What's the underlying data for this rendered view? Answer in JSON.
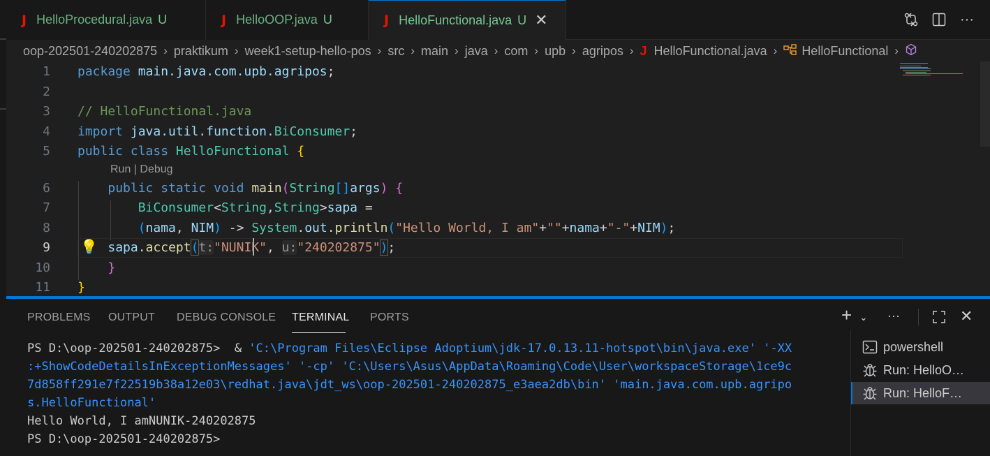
{
  "tabs": [
    {
      "icon": "J",
      "name": "HelloProcedural.java",
      "status": "U",
      "active": false
    },
    {
      "icon": "J",
      "name": "HelloOOP.java",
      "status": "U",
      "active": false
    },
    {
      "icon": "J",
      "name": "HelloFunctional.java",
      "status": "U",
      "active": true
    }
  ],
  "titlebar_actions": [
    "source-control-compare-icon",
    "split-editor-icon",
    "more-actions-icon"
  ],
  "breadcrumb": {
    "segments": [
      "oop-202501-240202875",
      "praktikum",
      "week1-setup-hello-pos",
      "src",
      "main",
      "java",
      "com",
      "upb",
      "agripos"
    ],
    "file": "HelloFunctional.java",
    "symbol": "HelloFunctional"
  },
  "editor": {
    "line_numbers": [
      "1",
      "2",
      "3",
      "4",
      "5",
      "6",
      "7",
      "8",
      "9",
      "10",
      "11"
    ],
    "current_line": "9",
    "codelens": "Run | Debug",
    "lines": {
      "l1_kw": "package",
      "l1_pkg": "main.java.com.upb.agripos",
      "l1_end": ";",
      "l3_comment": "// HelloFunctional.java",
      "l4_kw": "import",
      "l4_pkg": "java.util.function.",
      "l4_type": "BiConsumer",
      "l4_end": ";",
      "l5_kw1": "public",
      "l5_kw2": "class",
      "l5_type": "HelloFunctional",
      "l5_brace": "{",
      "l6_kw1": "public",
      "l6_kw2": "static",
      "l6_kw3": "void",
      "l6_fn": "main",
      "l6_p1": "(",
      "l6_type": "String",
      "l6_arr": "[]",
      "l6_var": "args",
      "l6_p2": ")",
      "l6_brace": "{",
      "l7_type1": "BiConsumer",
      "l7_lt": "<",
      "l7_type2": "String",
      "l7_comma": ",",
      "l7_type3": "String",
      "l7_gt": ">",
      "l7_var": "sapa",
      "l7_eq": " =",
      "l8_p1": "(",
      "l8_v1": "nama",
      "l8_c": ", ",
      "l8_v2": "NIM",
      "l8_p2": ")",
      "l8_arrow": " -> ",
      "l8_sys": "System",
      "l8_dot1": ".",
      "l8_out": "out",
      "l8_dot2": ".",
      "l8_fn": "println",
      "l8_p3": "(",
      "l8_s1": "\"Hello World, I am\"",
      "l8_plus1": "+",
      "l8_s2": "\"\"",
      "l8_plus2": "+",
      "l8_v3": "nama",
      "l8_plus3": "+",
      "l8_s3": "\"-\"",
      "l8_plus4": "+",
      "l8_v4": "NIM",
      "l8_p4": ")",
      "l8_end": ";",
      "l9_var": "sapa",
      "l9_dot": ".",
      "l9_fn": "accept",
      "l9_p1": "(",
      "l9_hint1": "t:",
      "l9_s1": "\"NUNIK\"",
      "l9_c": ", ",
      "l9_hint2": "u:",
      "l9_s2": "\"240202875\"",
      "l9_p2": ")",
      "l9_end": ";",
      "l10_brace": "}",
      "l11_brace": "}"
    }
  },
  "panel": {
    "tabs": [
      "PROBLEMS",
      "OUTPUT",
      "DEBUG CONSOLE",
      "TERMINAL",
      "PORTS"
    ],
    "active_tab": "TERMINAL",
    "terminal": {
      "prompt1": "PS D:\\oop-202501-240202875> ",
      "op": " & ",
      "cmd_l1": "'C:\\Program Files\\Eclipse Adoptium\\jdk-17.0.13.11-hotspot\\bin\\java.exe' '-XX",
      "cmd_l2": ":+ShowCodeDetailsInExceptionMessages' '-cp' 'C:\\Users\\Asus\\AppData\\Roaming\\Code\\User\\workspaceStorage\\1ce9c",
      "cmd_l3": "7d858ff291e7f22519b38a12e03\\redhat.java\\jdt_ws\\oop-202501-240202875_e3aea2db\\bin' 'main.java.com.upb.agripo",
      "cmd_l4": "s.HelloFunctional'",
      "output": "Hello World, I amNUNIK-240202875",
      "prompt2": "PS D:\\oop-202501-240202875> "
    },
    "terminal_list": [
      {
        "icon": "terminal-powershell-icon",
        "label": "powershell",
        "active": false
      },
      {
        "icon": "debug-icon",
        "label": "Run: HelloO…",
        "active": false
      },
      {
        "icon": "debug-icon",
        "label": "Run: HelloF…",
        "active": true
      }
    ]
  },
  "colors": {
    "accent": "#0078d4",
    "untracked": "#73c991",
    "java_icon": "#e51400",
    "string": "#ce9178",
    "keyword": "#569cd6",
    "type": "#4ec9b0"
  }
}
